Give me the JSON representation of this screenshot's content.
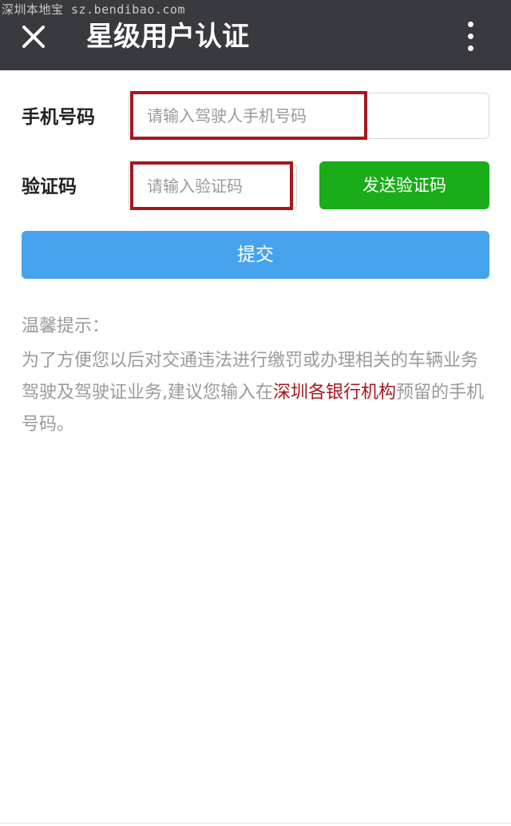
{
  "watermark": "深圳本地宝 sz.bendibao.com",
  "header": {
    "title": "星级用户认证",
    "close_icon": "close-icon",
    "more_icon": "more-vertical-icon"
  },
  "form": {
    "phone_label": "手机号码",
    "phone_placeholder": "请输入驾驶人手机号码",
    "phone_value": "",
    "code_label": "验证码",
    "code_placeholder": "请输入验证码",
    "code_value": "",
    "send_code_label": "发送验证码",
    "submit_label": "提交"
  },
  "tips": {
    "title": "温馨提示：",
    "body_before": "为了方便您以后对交通违法进行缴罚或办理相关的车辆业务驾驶及驾驶证业务,建议您输入在",
    "link_text": "深圳各银行机构",
    "body_after": "预留的手机号码。"
  },
  "colors": {
    "header_bg": "#393a3f",
    "send_button": "#1aad19",
    "submit_button": "#47a2ee",
    "highlight": "#a8161d",
    "link": "#a8161d"
  }
}
